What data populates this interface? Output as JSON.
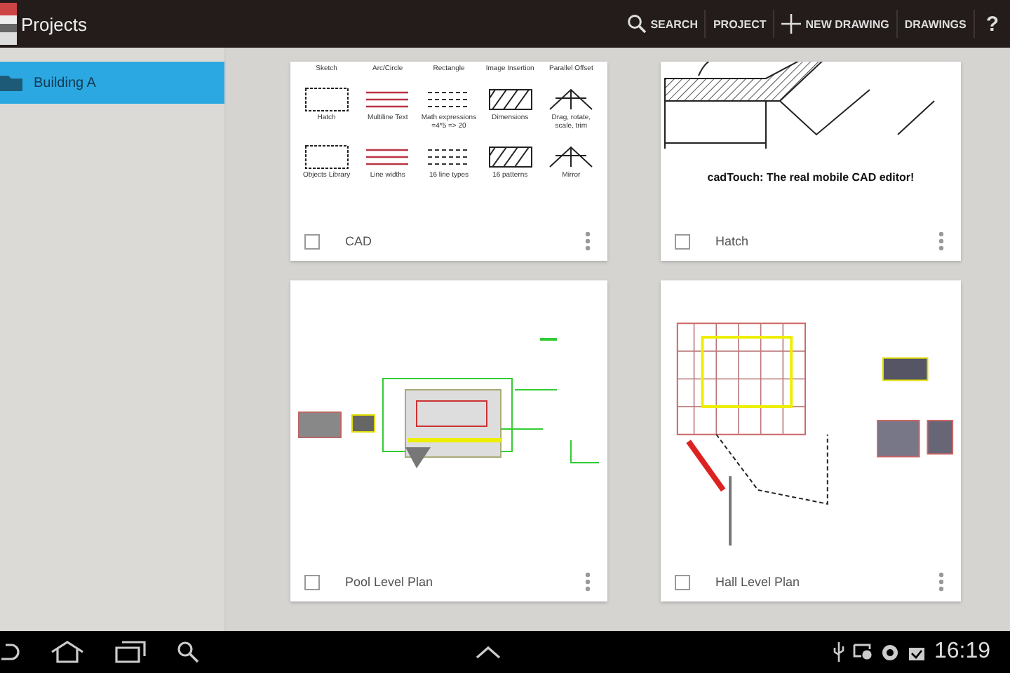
{
  "app_bar": {
    "title": "Projects",
    "actions": [
      {
        "kind": "search",
        "label": "SEARCH"
      },
      {
        "kind": "text",
        "label": "PROJECT"
      },
      {
        "kind": "add",
        "label": "NEW DRAWING"
      },
      {
        "kind": "text",
        "label": "DRAWINGS"
      },
      {
        "kind": "help",
        "label": "?"
      }
    ]
  },
  "sidebar": {
    "items": [
      {
        "label": "Building A",
        "selected": true
      }
    ]
  },
  "drawings": [
    {
      "name": "CAD",
      "checked": false,
      "kind": "features",
      "thumbnail_labels": [
        "Sketch",
        "Arc/Circle",
        "Rectangle",
        "Image Insertion",
        "Parallel Offset",
        "Hatch",
        "Multiline Text",
        "Math expressions =4*5 => 20",
        "Dimensions",
        "Drag, rotate, scale, trim",
        "Objects Library",
        "Line widths",
        "16 line types",
        "16 patterns",
        "Mirror"
      ]
    },
    {
      "name": "Hatch",
      "checked": false,
      "kind": "hatch",
      "caption": "cadTouch: The real mobile CAD editor!"
    },
    {
      "name": "Pool Level Plan",
      "checked": false,
      "kind": "pool_plan"
    },
    {
      "name": "Hall Level Plan",
      "checked": false,
      "kind": "hall_plan"
    }
  ],
  "status_bar": {
    "time": "16:19"
  }
}
